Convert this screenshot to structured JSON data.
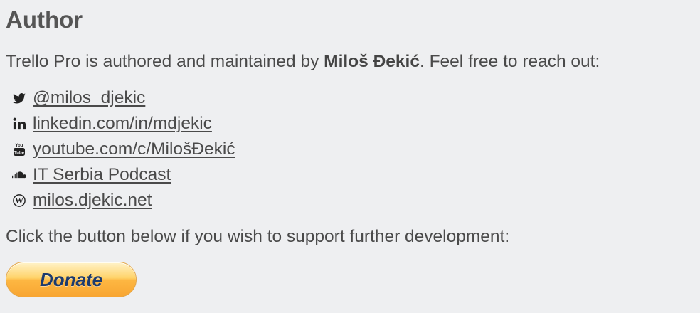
{
  "author_section": {
    "heading": "Author",
    "intro_prefix": "Trello Pro is authored and maintained by ",
    "author_name": "Miloš Đekić",
    "intro_suffix": ". Feel free to reach out:"
  },
  "links": [
    {
      "icon": "twitter-icon",
      "label": "@milos_djekic"
    },
    {
      "icon": "linkedin-icon",
      "label": "linkedin.com/in/mdjekic"
    },
    {
      "icon": "youtube-icon",
      "label": "youtube.com/c/MilošĐekić"
    },
    {
      "icon": "soundcloud-icon",
      "label": "IT Serbia Podcast"
    },
    {
      "icon": "wordpress-icon",
      "label": "milos.djekic.net"
    }
  ],
  "support_text": "Click the button below if you wish to support further development:",
  "donate": {
    "label": "Donate",
    "color": "#1d3b6e",
    "accent": "#fdb742"
  }
}
